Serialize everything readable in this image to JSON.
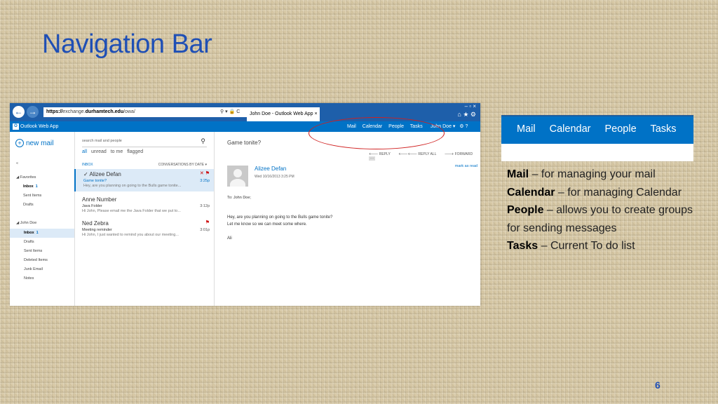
{
  "slide": {
    "title": "Navigation Bar",
    "page_number": "6"
  },
  "browser": {
    "back_icon": "arrow-left-icon",
    "url_prefix": "https://",
    "url_domain_part": "exchange.",
    "url_domain": "durhamtech.edu",
    "url_path": "/owa/",
    "tab_title": "John Doe - Outlook Web App",
    "window_controls": "–  ▫  ×",
    "toolbar_icons": "⌂ ★ ⚙"
  },
  "owa": {
    "app_name": "Outlook Web App",
    "nav": [
      "Mail",
      "Calendar",
      "People",
      "Tasks"
    ],
    "user": "John Doe ▾",
    "settings_icon": "⚙  ?",
    "highlight_color": "#d02020"
  },
  "left_pane": {
    "new_mail": "new mail",
    "collapse": "«",
    "favorites": "◢ Favorites",
    "inbox": "Inbox",
    "inbox_count": "1",
    "sent": "Sent Items",
    "drafts": "Drafts",
    "account": "◢ John Doe",
    "folders": [
      "Drafts",
      "Sent Items",
      "Deleted Items",
      "Junk Email",
      "Notes"
    ]
  },
  "message_list": {
    "search_placeholder": "search mail and people",
    "filters": [
      "all",
      "unread",
      "to me",
      "flagged"
    ],
    "folder": "INBOX",
    "sort": "CONVERSATIONS BY DATE ▾",
    "messages": [
      {
        "from": "✓ Alizee Defan",
        "subject": "Game tonite?",
        "preview": "Hey, are you planning on going to the Bulls game tonite...",
        "time": "3:25p",
        "flags": "✕ ⚑"
      },
      {
        "from": "Anne Number",
        "subject": "Java Folder",
        "preview": "Hi John, Please email me the Java Folder that we put to...",
        "time": "3:12p",
        "flags": ""
      },
      {
        "from": "Ned Zebra",
        "subject": "Meeting reminder",
        "preview": "Hi John, I just wanted to remind you about our meeting...",
        "time": "3:01p",
        "flags": "⚑"
      }
    ]
  },
  "reading_pane": {
    "subject": "Game tonite?",
    "actions": [
      "🡐 REPLY",
      "🡐🡐 REPLY ALL",
      "🡒 FORWARD"
    ],
    "mark_as_read": "mark as read",
    "from": "Alizee Defan",
    "date": "Wed 10/16/2013 3:25 PM",
    "to": "To:  John Doe;",
    "body": [
      "Hey, are you planning on going to the Bulls game tonite?",
      "Let me know so we can meet some where.",
      "Ali"
    ]
  },
  "callout": {
    "nav_items": [
      "Mail",
      "Calendar",
      "People",
      "Tasks"
    ],
    "descriptions": [
      {
        "term": "Mail",
        "text": " – for managing your mail"
      },
      {
        "term": "Calendar",
        "text": " – for managing Calendar"
      },
      {
        "term": "People",
        "text": " – allows you to create groups for sending messages"
      },
      {
        "term": "Tasks",
        "text": " – Current To do list"
      }
    ]
  }
}
